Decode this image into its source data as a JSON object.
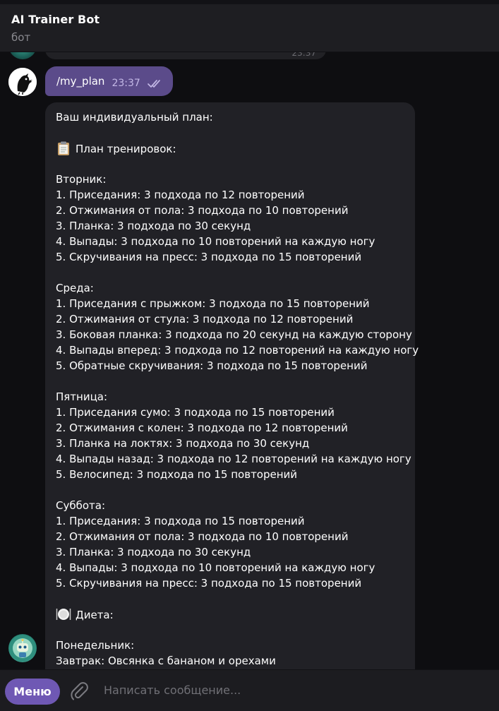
{
  "header": {
    "title": "AI Trainer Bot",
    "subtitle": "бот"
  },
  "previous_message": {
    "time": "23:37"
  },
  "user_message": {
    "text": "/my_plan",
    "time": "23:37"
  },
  "bot_message": {
    "lines": [
      {
        "text": "Ваш индивидуальный план:"
      },
      {
        "text": ""
      },
      {
        "text": "План тренировок:",
        "icon": "clipboard-icon"
      },
      {
        "text": ""
      },
      {
        "text": "Вторник:"
      },
      {
        "text": "1. Приседания: 3 подхода по 12 повторений"
      },
      {
        "text": "2. Отжимания от пола: 3 подхода по 10 повторений"
      },
      {
        "text": "3. Планка: 3 подхода по 30 секунд"
      },
      {
        "text": "4. Выпады: 3 подхода по 10 повторений на каждую ногу"
      },
      {
        "text": "5. Скручивания на пресс: 3 подхода по 15 повторений"
      },
      {
        "text": ""
      },
      {
        "text": "Среда:"
      },
      {
        "text": "1. Приседания с прыжком: 3 подхода по 15 повторений"
      },
      {
        "text": "2. Отжимания от стула: 3 подхода по 12 повторений"
      },
      {
        "text": "3. Боковая планка: 3 подхода по 20 секунд на каждую сторону"
      },
      {
        "text": "4. Выпады вперед: 3 подхода по 12 повторений на каждую ногу"
      },
      {
        "text": "5. Обратные скручивания: 3 подхода по 15 повторений"
      },
      {
        "text": ""
      },
      {
        "text": "Пятница:"
      },
      {
        "text": "1. Приседания сумо: 3 подхода по 15 повторений"
      },
      {
        "text": "2. Отжимания с колен: 3 подхода по 12 повторений"
      },
      {
        "text": "3. Планка на локтях: 3 подхода по 30 секунд"
      },
      {
        "text": "4. Выпады назад: 3 подхода по 12 повторений на каждую ногу"
      },
      {
        "text": "5. Велосипед: 3 подхода по 15 повторений"
      },
      {
        "text": ""
      },
      {
        "text": "Суббота:"
      },
      {
        "text": "1. Приседания: 3 подхода по 15 повторений"
      },
      {
        "text": "2. Отжимания от пола: 3 подхода по 10 повторений"
      },
      {
        "text": "3. Планка: 3 подхода по 30 секунд"
      },
      {
        "text": "4. Выпады: 3 подхода по 10 повторений на каждую ногу"
      },
      {
        "text": "5. Скручивания на пресс: 3 подхода по 15 повторений"
      },
      {
        "text": ""
      },
      {
        "text": "Диета:",
        "icon": "plate-icon"
      },
      {
        "text": ""
      },
      {
        "text": "Понедельник:"
      },
      {
        "text": "Завтрак: Овсянка с бананом и орехами"
      },
      {
        "text": ""
      }
    ]
  },
  "composer": {
    "menu_label": "Меню",
    "placeholder": "Написать сообщение..."
  },
  "colors": {
    "accent": "#6f58b4",
    "user_bubble": "#5b4b8a",
    "bot_bubble": "#212126",
    "background": "#0e0e11"
  }
}
